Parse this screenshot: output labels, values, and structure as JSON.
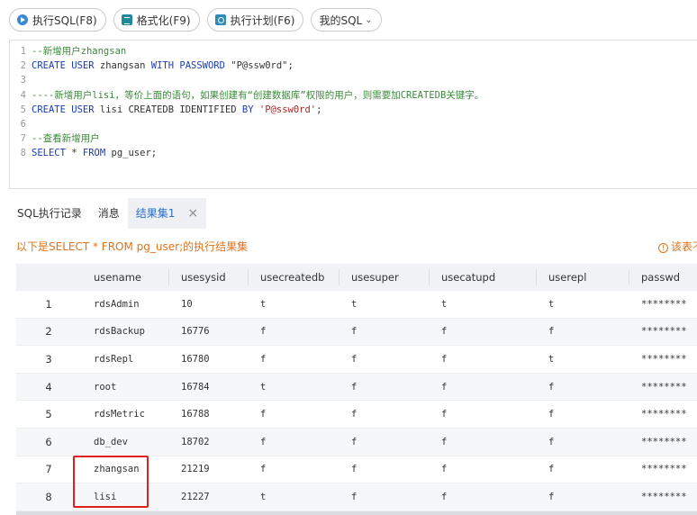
{
  "toolbar": {
    "run_label": "执行SQL(F8)",
    "format_label": "格式化(F9)",
    "plan_label": "执行计划(F6)",
    "my_sql_label": "我的SQL"
  },
  "editor": {
    "lines": [
      {
        "n": "1",
        "tokens": [
          {
            "t": "--新增用户zhangsan",
            "c": "cm"
          }
        ]
      },
      {
        "n": "2",
        "tokens": [
          {
            "t": "CREATE USER",
            "c": "kw"
          },
          {
            "t": " zhangsan ",
            "c": "pl"
          },
          {
            "t": "WITH PASSWORD",
            "c": "kw"
          },
          {
            "t": " \"P@ssw0rd\";",
            "c": "pl"
          }
        ]
      },
      {
        "n": "3",
        "tokens": []
      },
      {
        "n": "4",
        "tokens": [
          {
            "t": "----新增用户lisi，等价上面的语句，如果创建有“创建数据库”权限的用户，则需要加CREATEDB关键字。",
            "c": "cm"
          }
        ]
      },
      {
        "n": "5",
        "tokens": [
          {
            "t": "CREATE USER",
            "c": "kw"
          },
          {
            "t": " lisi CREATEDB IDENTIFIED ",
            "c": "pl"
          },
          {
            "t": "BY",
            "c": "kw"
          },
          {
            "t": " ",
            "c": "pl"
          },
          {
            "t": "'P@ssw0rd'",
            "c": "str"
          },
          {
            "t": ";",
            "c": "pl"
          }
        ]
      },
      {
        "n": "6",
        "tokens": []
      },
      {
        "n": "7",
        "tokens": [
          {
            "t": "--查看新增用户",
            "c": "cm"
          }
        ]
      },
      {
        "n": "8",
        "tokens": [
          {
            "t": "SELECT",
            "c": "kw"
          },
          {
            "t": " * ",
            "c": "pl"
          },
          {
            "t": "FROM",
            "c": "kw"
          },
          {
            "t": " pg_user;",
            "c": "pl"
          }
        ]
      }
    ]
  },
  "tabs": {
    "history": "SQL执行记录",
    "messages": "消息",
    "result": "结果集1",
    "close": "×"
  },
  "result_info": "以下是SELECT * FROM pg_user;的执行结果集",
  "result_info_right": "该表不",
  "table": {
    "columns": [
      "",
      "usename",
      "usesysid",
      "usecreatedb",
      "usesuper",
      "usecatupd",
      "userepl",
      "passwd"
    ],
    "rows": [
      [
        "1",
        "rdsAdmin",
        "10",
        "t",
        "t",
        "t",
        "t",
        "********"
      ],
      [
        "2",
        "rdsBackup",
        "16776",
        "f",
        "f",
        "f",
        "f",
        "********"
      ],
      [
        "3",
        "rdsRepl",
        "16780",
        "f",
        "f",
        "f",
        "t",
        "********"
      ],
      [
        "4",
        "root",
        "16784",
        "t",
        "f",
        "f",
        "f",
        "********"
      ],
      [
        "5",
        "rdsMetric",
        "16788",
        "f",
        "f",
        "f",
        "f",
        "********"
      ],
      [
        "6",
        "db_dev",
        "18702",
        "f",
        "f",
        "f",
        "f",
        "********"
      ],
      [
        "7",
        "zhangsan",
        "21219",
        "f",
        "f",
        "f",
        "f",
        "********"
      ],
      [
        "8",
        "lisi",
        "21227",
        "t",
        "f",
        "f",
        "f",
        "********"
      ]
    ]
  },
  "colors": {
    "accent": "#2a6fc9",
    "info": "#e0731a",
    "highlight": "#e02020"
  }
}
